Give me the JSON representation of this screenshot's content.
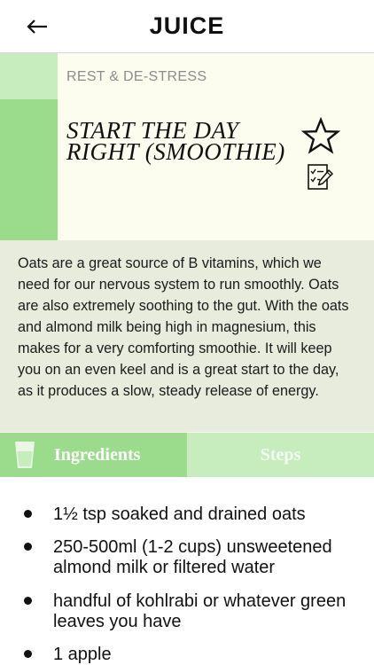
{
  "header": {
    "title": "JUICE",
    "back_icon": "arrow-left-icon"
  },
  "hero": {
    "category": "REST & DE-STRESS",
    "title": "START THE DAY RIGHT (SMOOTHIE)",
    "favorite_icon": "star-outline-icon",
    "notes_icon": "notes-pencil-icon",
    "colors": {
      "bar_light": "#c7edbf",
      "bar_dark": "#9bdc8c",
      "background": "#fcfdee"
    }
  },
  "description": "Oats are a great source of B vitamins, which we need for our nervous system to run smoothly. Oats are also extremely soothing to the gut. With the oats and almond milk being high in magnesium, this makes for a very comforting smoothie. It will keep you on an even keel and is a great start to the day, as it produces a slow, steady release of energy.",
  "tabs": {
    "ingredients_label": "Ingredients",
    "steps_label": "Steps",
    "ingredients_icon": "glass-icon",
    "active": "Ingredients"
  },
  "ingredients": [
    "1½ tsp soaked and drained oats",
    "250-500ml (1-2 cups) unsweetened almond milk or filtered water",
    "handful of kohlrabi or whatever green leaves you have",
    "1 apple"
  ]
}
